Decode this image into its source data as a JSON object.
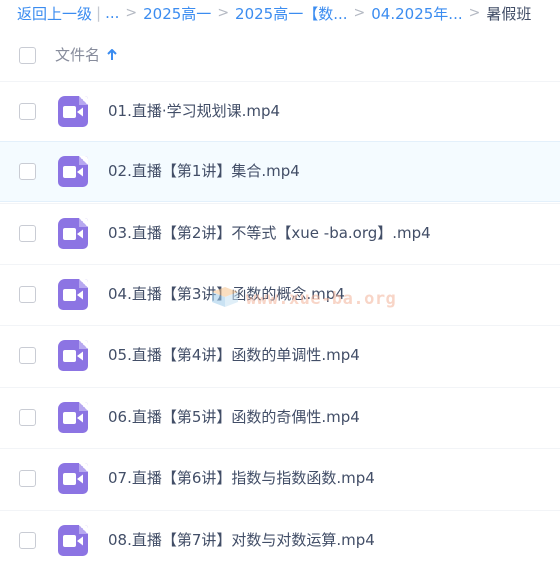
{
  "breadcrumb": {
    "back_label": "返回上一级",
    "ellipsis": "...",
    "items": [
      "2025高一",
      "2025高一【数...",
      "04.2025年..."
    ],
    "current": "暑假班"
  },
  "header": {
    "name_label": "文件名",
    "sort_icon": "arrow-up-icon"
  },
  "files": [
    {
      "name": "01.直播·学习规划课.mp4",
      "icon": "video-file-icon",
      "selected": false
    },
    {
      "name": "02.直播【第1讲】集合.mp4",
      "icon": "video-file-icon",
      "selected": false
    },
    {
      "name": "03.直播【第2讲】不等式【xue -ba.org】.mp4",
      "icon": "video-file-icon",
      "selected": false
    },
    {
      "name": "04.直播【第3讲】函数的概念.mp4",
      "icon": "video-file-icon",
      "selected": false
    },
    {
      "name": "05.直播【第4讲】函数的单调性.mp4",
      "icon": "video-file-icon",
      "selected": false
    },
    {
      "name": "06.直播【第5讲】函数的奇偶性.mp4",
      "icon": "video-file-icon",
      "selected": false
    },
    {
      "name": "07.直播【第6讲】指数与指数函数.mp4",
      "icon": "video-file-icon",
      "selected": false
    },
    {
      "name": "08.直播【第7讲】对数与对数运算.mp4",
      "icon": "video-file-icon",
      "selected": false
    }
  ],
  "watermark": {
    "text": "www.xue-ba.org"
  },
  "colors": {
    "link": "#3b8cf0",
    "text": "#424e67",
    "video_icon": "#8c74e3",
    "hover_row": "#f4fbff"
  }
}
